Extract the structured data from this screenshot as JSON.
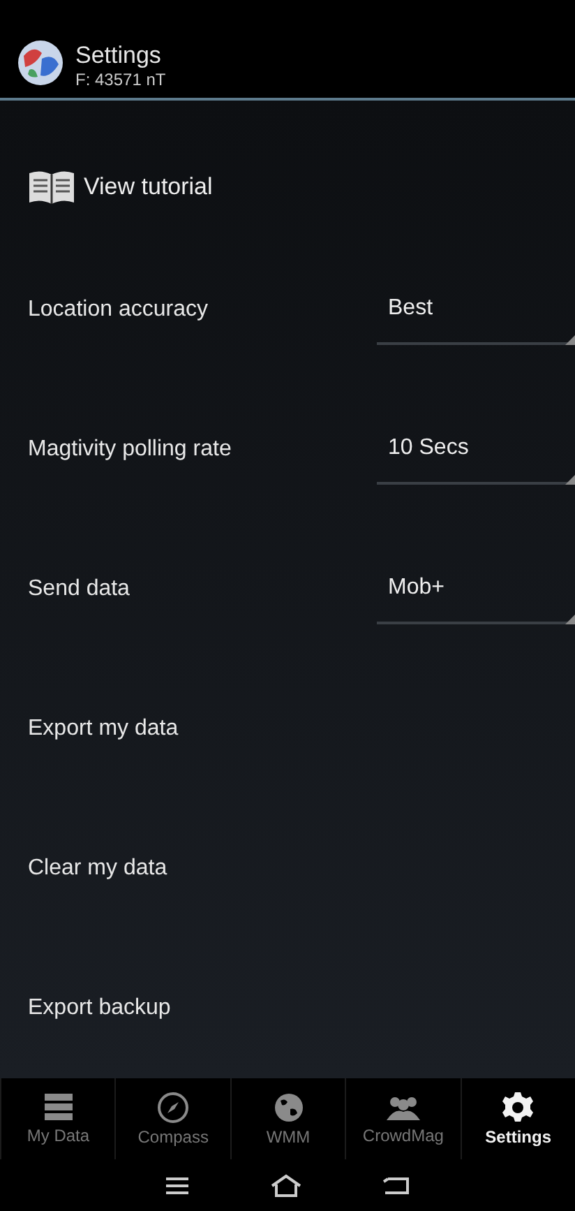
{
  "header": {
    "title": "Settings",
    "subtitle": "F: 43571 nT"
  },
  "tutorial": {
    "label": "View tutorial"
  },
  "settings": [
    {
      "kind": "dropdown",
      "label": "Location accuracy",
      "value": "Best"
    },
    {
      "kind": "dropdown",
      "label": "Magtivity polling rate",
      "value": "10 Secs"
    },
    {
      "kind": "dropdown",
      "label": "Send data",
      "value": "Mob+"
    },
    {
      "kind": "action",
      "label": "Export my data"
    },
    {
      "kind": "action",
      "label": "Clear my data"
    },
    {
      "kind": "action",
      "label": "Export backup"
    }
  ],
  "tabs": [
    {
      "kind": "data",
      "label": "My Data",
      "selected": false
    },
    {
      "kind": "compass",
      "label": "Compass",
      "selected": false
    },
    {
      "kind": "globe",
      "label": "WMM",
      "selected": false
    },
    {
      "kind": "people",
      "label": "CrowdMag",
      "selected": false
    },
    {
      "kind": "gear",
      "label": "Settings",
      "selected": true
    }
  ]
}
